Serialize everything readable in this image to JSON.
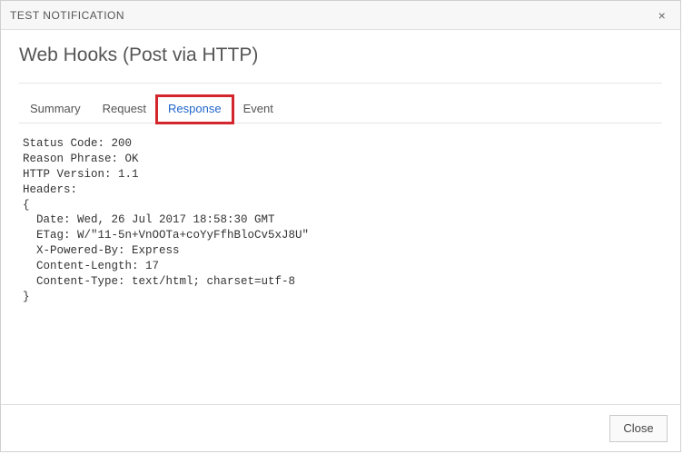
{
  "titlebar": {
    "title": "TEST NOTIFICATION",
    "close_glyph": "×"
  },
  "page": {
    "title": "Web Hooks (Post via HTTP)"
  },
  "tabs": {
    "summary": "Summary",
    "request": "Request",
    "response": "Response",
    "event": "Event"
  },
  "response": {
    "status_code_label": "Status Code:",
    "status_code": "200",
    "reason_label": "Reason Phrase:",
    "reason": "OK",
    "http_version_label": "HTTP Version:",
    "http_version": "1.1",
    "headers_label": "Headers:",
    "headers": {
      "Date": "Wed, 26 Jul 2017 18:58:30 GMT",
      "ETag": "W/\"11-5n+VnOOTa+coYyFfhBloCv5xJ8U\"",
      "X-Powered-By": "Express",
      "Content-Length": "17",
      "Content-Type": "text/html; charset=utf-8"
    }
  },
  "footer": {
    "close_label": "Close"
  }
}
